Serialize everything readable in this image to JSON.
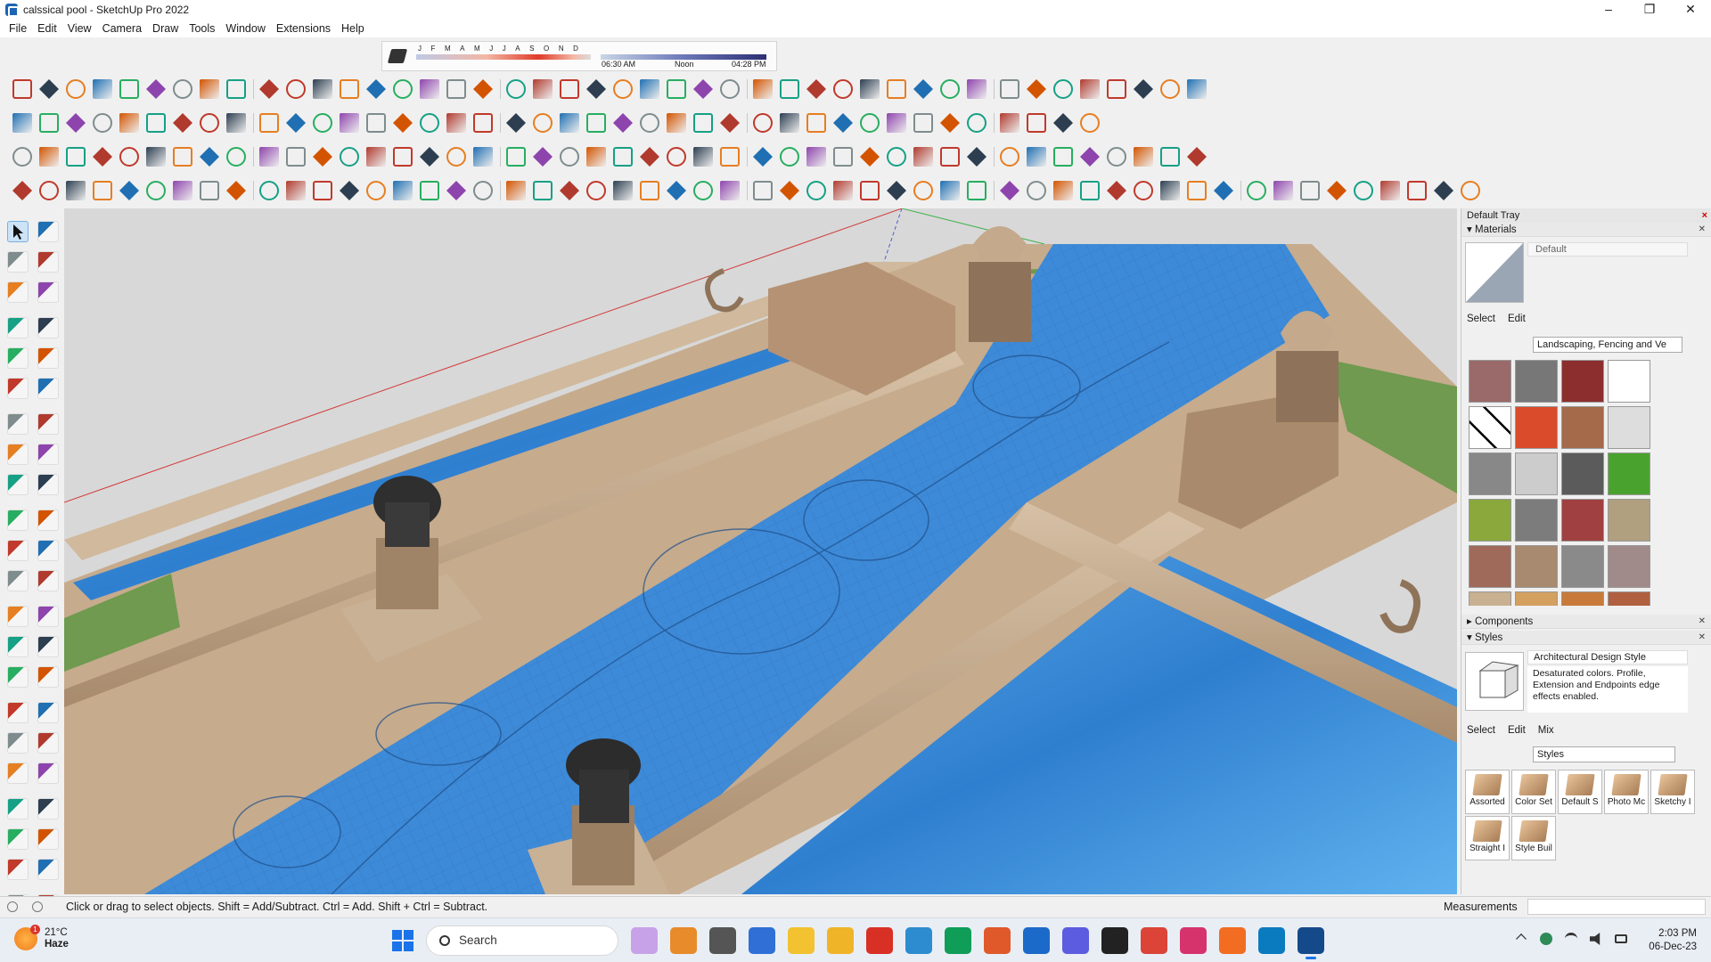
{
  "window": {
    "title": "calssical pool - SketchUp Pro 2022",
    "controls": [
      "–",
      "❐",
      "✕"
    ]
  },
  "menu": [
    "File",
    "Edit",
    "View",
    "Camera",
    "Draw",
    "Tools",
    "Window",
    "Extensions",
    "Help"
  ],
  "shadows": {
    "months": [
      "J",
      "F",
      "M",
      "A",
      "M",
      "J",
      "J",
      "A",
      "S",
      "O",
      "N",
      "D"
    ],
    "time_start": "06:30 AM",
    "time_mid": "Noon",
    "time_end": "04:28 PM"
  },
  "tray": {
    "title": "Default Tray",
    "materials": {
      "header": "Materials",
      "current": "Default",
      "tabs": [
        "Select",
        "Edit"
      ],
      "collection": "Landscaping, Fencing and Ve"
    },
    "components": {
      "header": "Components"
    },
    "styles": {
      "header": "Styles",
      "current_name": "Architectural Design Style",
      "description": "Desaturated colors. Profile, Extension and Endpoints edge effects enabled.",
      "tabs": [
        "Select",
        "Edit",
        "Mix"
      ],
      "collection": "Styles",
      "items": [
        "Assorted",
        "Color Set",
        "Default S",
        "Photo Mc",
        "Sketchy I",
        "Straight I",
        "Style Buil"
      ]
    }
  },
  "status": {
    "hint": "Click or drag to select objects. Shift = Add/Subtract. Ctrl = Add. Shift + Ctrl = Subtract.",
    "measurements_label": "Measurements",
    "measurements_value": ""
  },
  "taskbar": {
    "temperature": "21°C",
    "condition": "Haze",
    "badge": "1",
    "search_placeholder": "Search",
    "time": "2:03 PM",
    "date": "06-Dec-23"
  },
  "colors": {
    "water": "#3a86d6",
    "stone": "#c9b196",
    "grass": "#6f9a4f",
    "accent": "#1a73e8"
  }
}
